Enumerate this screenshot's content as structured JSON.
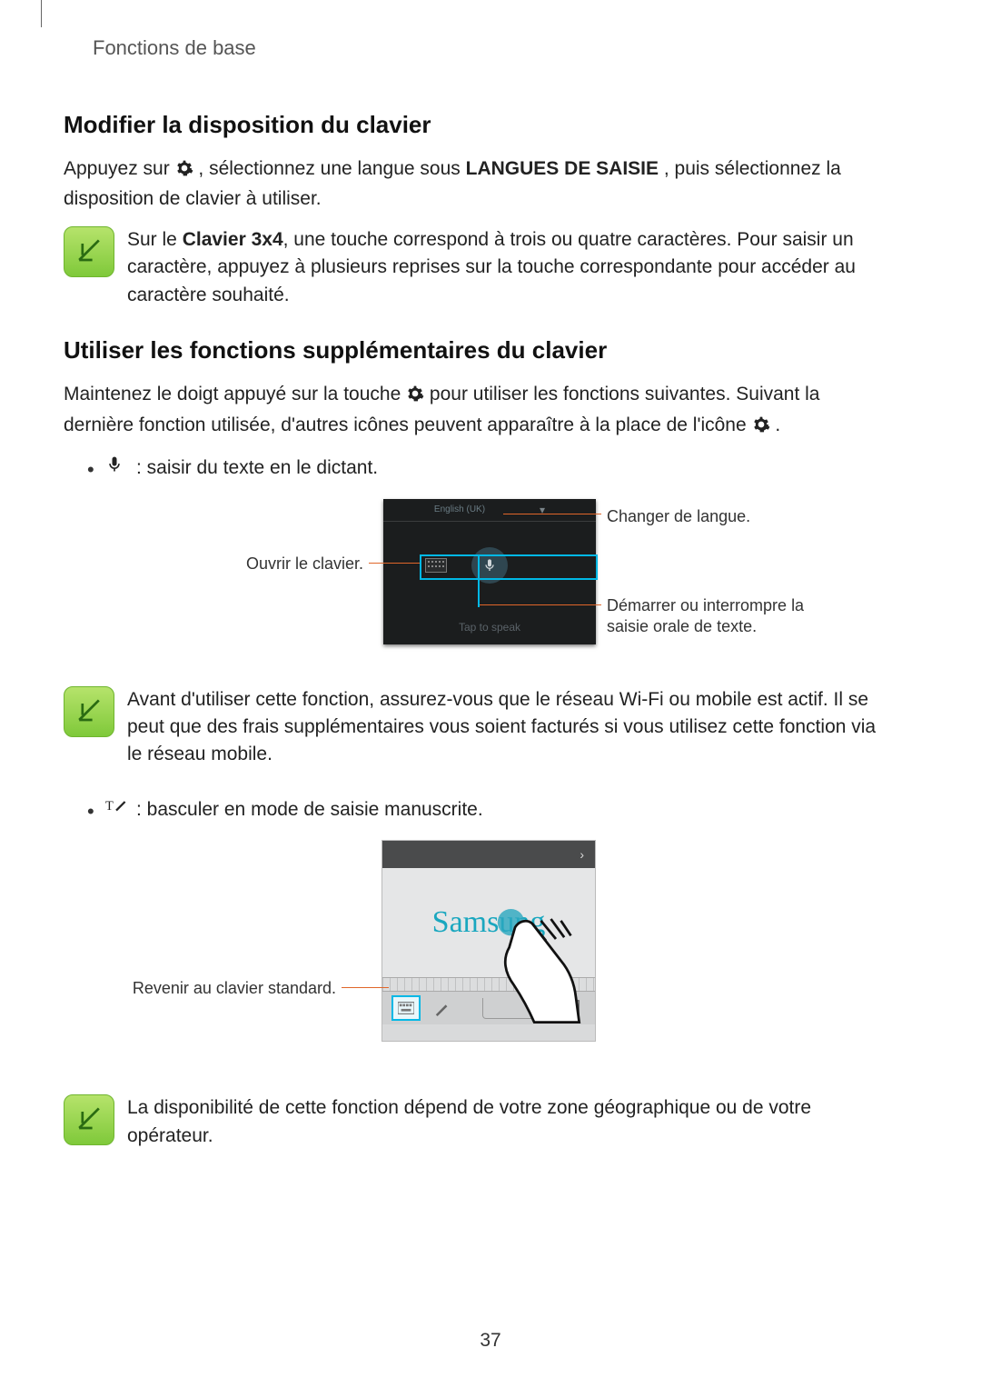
{
  "header": {
    "breadcrumb": "Fonctions de base"
  },
  "section1": {
    "title": "Modifier la disposition du clavier",
    "p1_a": "Appuyez sur ",
    "p1_b": ", sélectionnez une langue sous ",
    "p1_bold": "LANGUES DE SAISIE",
    "p1_c": ", puis sélectionnez la disposition de clavier à utiliser.",
    "note_a": "Sur le ",
    "note_bold": "Clavier 3x4",
    "note_b": ", une touche correspond à trois ou quatre caractères. Pour saisir un caractère, appuyez à plusieurs reprises sur la touche correspondante pour accéder au caractère souhaité."
  },
  "section2": {
    "title": "Utiliser les fonctions supplémentaires du clavier",
    "p1_a": "Maintenez le doigt appuyé sur la touche ",
    "p1_b": " pour utiliser les fonctions suivantes. Suivant la dernière fonction utilisée, d'autres icônes peuvent apparaître à la place de l'icône ",
    "p1_c": ".",
    "bullet1": " : saisir du texte en le dictant.",
    "fig1": {
      "left_label": "Ouvrir le clavier.",
      "right_label_1": "Changer de langue.",
      "right_label_2": "Démarrer ou interrompre la saisie orale de texte.",
      "panel_lang": "English (UK)",
      "panel_bottom": "Tap to speak"
    },
    "note2": "Avant d'utiliser cette fonction, assurez-vous que le réseau Wi-Fi ou mobile est actif. Il se peut que des frais supplémentaires vous soient facturés si vous utilisez cette fonction via le réseau mobile.",
    "bullet2": " : basculer en mode de saisie manuscrite.",
    "fig2": {
      "left_label": "Revenir au clavier standard.",
      "hw_text": "Samsung"
    },
    "note3": "La disponibilité de cette fonction dépend de votre zone géographique ou de votre opérateur."
  },
  "page_number": "37"
}
